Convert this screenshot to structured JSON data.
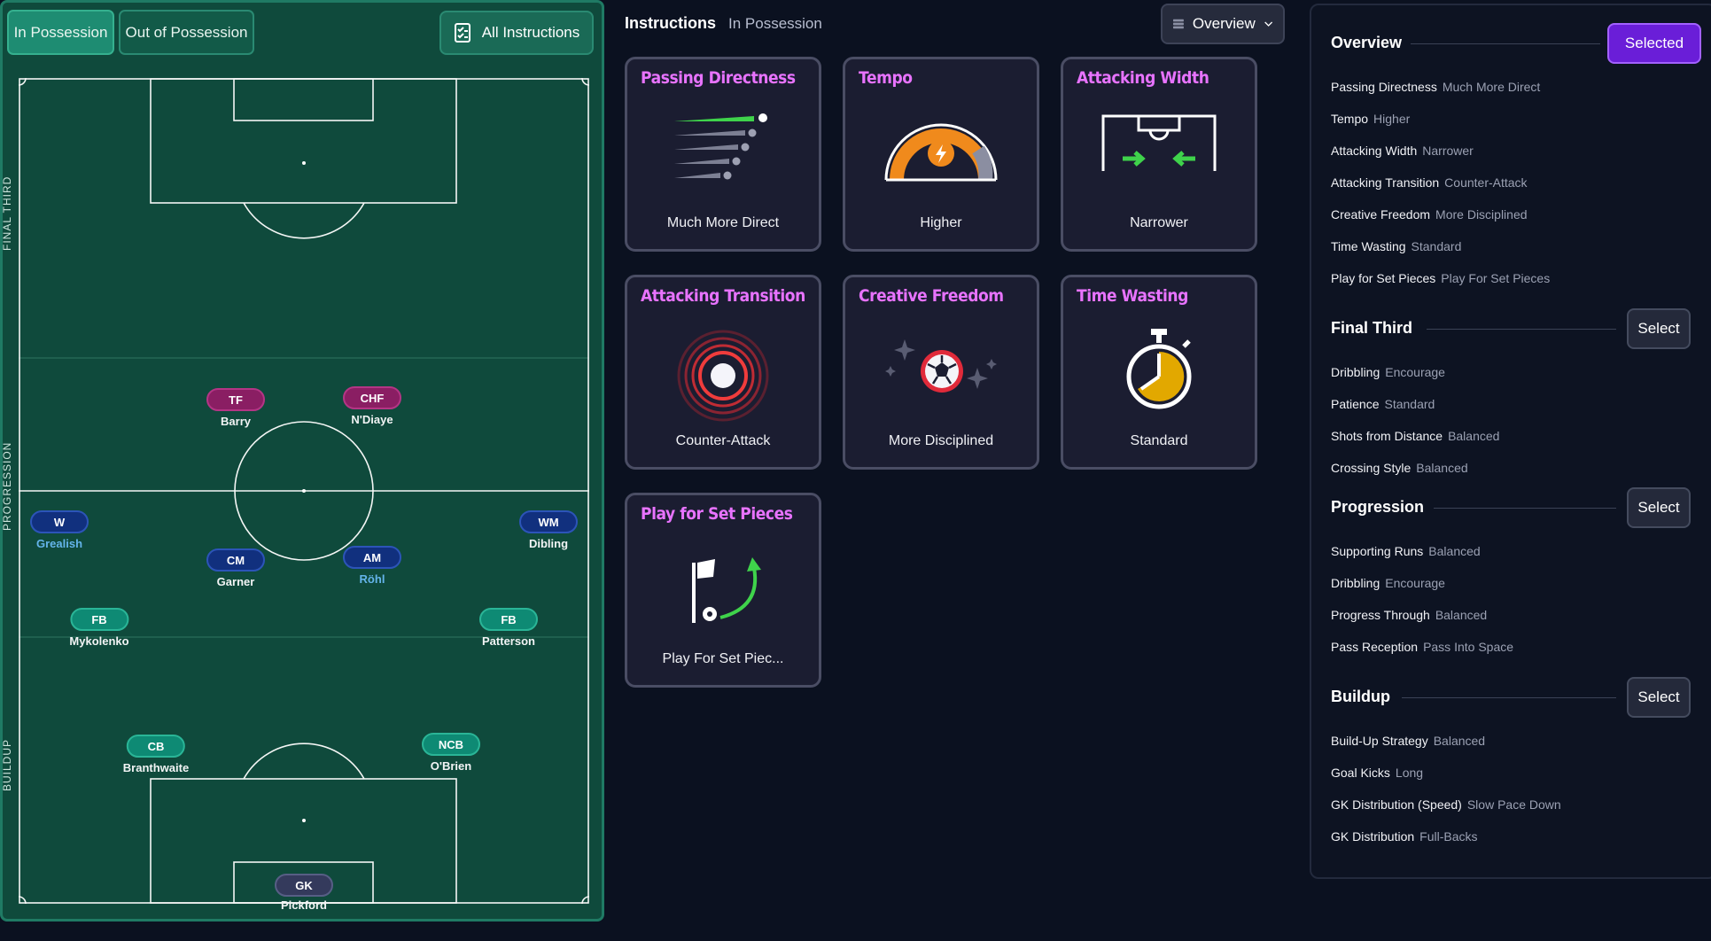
{
  "pitch_tabs": {
    "in_possession": "In Possession",
    "out_of_possession": "Out of Possession",
    "all_instructions": "All Instructions"
  },
  "zones": {
    "final_third": "FINAL THIRD",
    "progression": "PROGRESSION",
    "buildup": "BUILDUP"
  },
  "players": [
    {
      "pos": "TF",
      "name": "Barry",
      "color": "pink",
      "highlight": false
    },
    {
      "pos": "CHF",
      "name": "N'Diaye",
      "color": "pink",
      "highlight": false
    },
    {
      "pos": "W",
      "name": "Grealish",
      "color": "blue",
      "highlight": true
    },
    {
      "pos": "WM",
      "name": "Dibling",
      "color": "blue",
      "highlight": false
    },
    {
      "pos": "CM",
      "name": "Garner",
      "color": "blue",
      "highlight": false
    },
    {
      "pos": "AM",
      "name": "Röhl",
      "color": "blue",
      "highlight": true
    },
    {
      "pos": "FB",
      "name": "Mykolenko",
      "color": "teal",
      "highlight": false
    },
    {
      "pos": "FB",
      "name": "Patterson",
      "color": "teal",
      "highlight": false
    },
    {
      "pos": "CB",
      "name": "Branthwaite",
      "color": "teal",
      "highlight": false
    },
    {
      "pos": "NCB",
      "name": "O'Brien",
      "color": "teal",
      "highlight": false
    },
    {
      "pos": "GK",
      "name": "Pickford",
      "color": "gray",
      "highlight": false
    }
  ],
  "center": {
    "title": "Instructions",
    "subtitle": "In Possession",
    "dropdown": "Overview"
  },
  "cards": [
    {
      "title": "Passing Directness",
      "value": "Much More Direct",
      "icon": "passing-directness-icon"
    },
    {
      "title": "Tempo",
      "value": "Higher",
      "icon": "tempo-gauge-icon"
    },
    {
      "title": "Attacking Width",
      "value": "Narrower",
      "icon": "attacking-width-icon"
    },
    {
      "title": "Attacking Transition",
      "value": "Counter-Attack",
      "icon": "target-rings-icon"
    },
    {
      "title": "Creative Freedom",
      "value": "More Disciplined",
      "icon": "football-sparkle-icon"
    },
    {
      "title": "Time Wasting",
      "value": "Standard",
      "icon": "stopwatch-icon"
    },
    {
      "title": "Play for Set Pieces",
      "value": "Play For Set Piec...",
      "icon": "corner-flag-icon"
    }
  ],
  "right_panel": {
    "overview": {
      "title": "Overview",
      "button": "Selected",
      "rows": [
        {
          "k": "Passing Directness",
          "v": "Much More Direct"
        },
        {
          "k": "Tempo",
          "v": "Higher"
        },
        {
          "k": "Attacking Width",
          "v": "Narrower"
        },
        {
          "k": "Attacking Transition",
          "v": "Counter-Attack"
        },
        {
          "k": "Creative Freedom",
          "v": "More Disciplined"
        },
        {
          "k": "Time Wasting",
          "v": "Standard"
        },
        {
          "k": "Play for Set Pieces",
          "v": "Play For Set Pieces"
        }
      ]
    },
    "final_third": {
      "title": "Final Third",
      "button": "Select",
      "rows": [
        {
          "k": "Dribbling",
          "v": "Encourage"
        },
        {
          "k": "Patience",
          "v": "Standard"
        },
        {
          "k": "Shots from Distance",
          "v": "Balanced"
        },
        {
          "k": "Crossing Style",
          "v": "Balanced"
        }
      ]
    },
    "progression": {
      "title": "Progression",
      "button": "Select",
      "rows": [
        {
          "k": "Supporting Runs",
          "v": "Balanced"
        },
        {
          "k": "Dribbling",
          "v": "Encourage"
        },
        {
          "k": "Progress Through",
          "v": "Balanced"
        },
        {
          "k": "Pass Reception",
          "v": "Pass Into Space"
        }
      ]
    },
    "buildup": {
      "title": "Buildup",
      "button": "Select",
      "rows": [
        {
          "k": "Build-Up Strategy",
          "v": "Balanced"
        },
        {
          "k": "Goal Kicks",
          "v": "Long"
        },
        {
          "k": "GK Distribution (Speed)",
          "v": "Slow Pace Down"
        },
        {
          "k": "GK Distribution",
          "v": "Full-Backs"
        }
      ]
    }
  },
  "colors": {
    "accent_purple": "#6a1ed8",
    "card_title": "#e873ff",
    "pitch_green": "#0f4a3c"
  }
}
